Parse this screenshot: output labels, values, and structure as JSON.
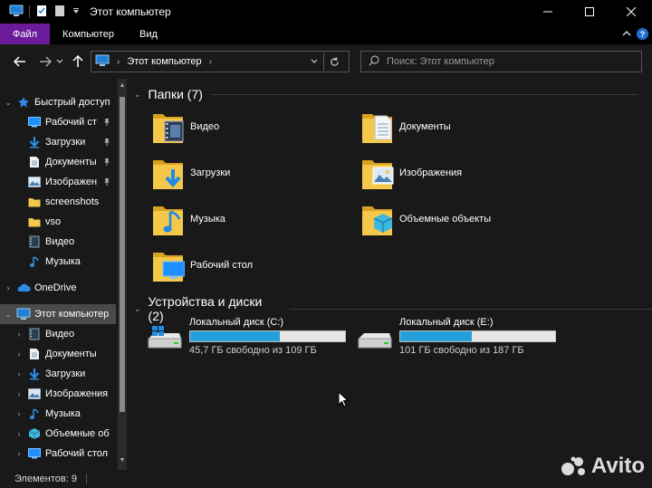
{
  "window": {
    "title": "Этот компьютер"
  },
  "ribbon": {
    "tabs": [
      {
        "label": "Файл"
      },
      {
        "label": "Компьютер"
      },
      {
        "label": "Вид"
      }
    ],
    "help_label": "?"
  },
  "address": {
    "path": "Этот компьютер",
    "search_placeholder": "Поиск: Этот компьютер"
  },
  "sidebar": {
    "items": [
      {
        "label": "Быстрый доступ",
        "icon": "star-icon",
        "pinned": false,
        "expand": "v"
      },
      {
        "label": "Рабочий ст",
        "icon": "desktop-icon",
        "pinned": true
      },
      {
        "label": "Загрузки",
        "icon": "download-icon",
        "pinned": true
      },
      {
        "label": "Документы",
        "icon": "documents-icon",
        "pinned": true
      },
      {
        "label": "Изображен",
        "icon": "pictures-icon",
        "pinned": true
      },
      {
        "label": "screenshots",
        "icon": "folder-icon",
        "pinned": false
      },
      {
        "label": "vso",
        "icon": "folder-icon",
        "pinned": false
      },
      {
        "label": "Видео",
        "icon": "video-icon",
        "pinned": false
      },
      {
        "label": "Музыка",
        "icon": "music-icon",
        "pinned": false
      },
      {
        "label": "OneDrive",
        "icon": "onedrive-icon",
        "pinned": false,
        "expand": ">"
      },
      {
        "label": "Этот компьютер",
        "icon": "pc-icon",
        "pinned": false,
        "expand": "v",
        "selected": true
      },
      {
        "label": "Видео",
        "icon": "video-icon",
        "expand": ">"
      },
      {
        "label": "Документы",
        "icon": "documents-icon",
        "expand": ">"
      },
      {
        "label": "Загрузки",
        "icon": "download-icon",
        "expand": ">"
      },
      {
        "label": "Изображения",
        "icon": "pictures-icon",
        "expand": ">"
      },
      {
        "label": "Музыка",
        "icon": "music-icon",
        "expand": ">"
      },
      {
        "label": "Объемные об",
        "icon": "3d-objects-icon",
        "expand": ">"
      },
      {
        "label": "Рабочий стол",
        "icon": "desktop-icon",
        "expand": ">"
      }
    ]
  },
  "folders": {
    "header": "Папки (7)",
    "items": [
      {
        "label": "Видео",
        "overlay": "video"
      },
      {
        "label": "Документы",
        "overlay": "documents"
      },
      {
        "label": "Загрузки",
        "overlay": "download"
      },
      {
        "label": "Изображения",
        "overlay": "pictures"
      },
      {
        "label": "Музыка",
        "overlay": "music"
      },
      {
        "label": "Объемные объекты",
        "overlay": "3d"
      },
      {
        "label": "Рабочий стол",
        "overlay": "desktop"
      }
    ]
  },
  "drives": {
    "header": "Устройства и диски (2)",
    "items": [
      {
        "name": "Локальный диск (C:)",
        "free_text": "45,7 ГБ свободно из 109 ГБ",
        "used_fraction": 0.58,
        "windows": true
      },
      {
        "name": "Локальный диск (E:)",
        "free_text": "101 ГБ свободно из 187 ГБ",
        "used_fraction": 0.46,
        "windows": false
      }
    ]
  },
  "status": {
    "items_count": "Элементов: 9"
  },
  "watermark": {
    "text": "Avito"
  },
  "colors": {
    "file_tab": "#6b1b9a",
    "drive_fill": "#26a0da",
    "background": "#191919",
    "folder_yellow": "#f4c84a"
  }
}
